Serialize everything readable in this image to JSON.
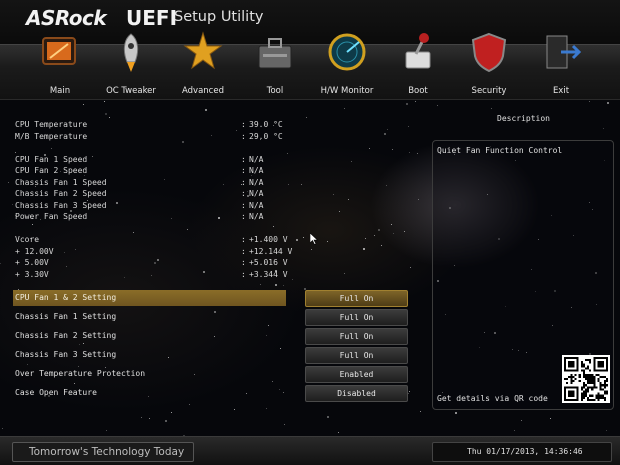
{
  "header": {
    "brand": "ASRock",
    "product": "UEFI",
    "subtitle": "Setup Utility"
  },
  "nav": [
    {
      "label": "Main",
      "icon": "main-icon",
      "color": "#d86a1c"
    },
    {
      "label": "OC Tweaker",
      "icon": "rocket-icon",
      "color": "#c8c8c8"
    },
    {
      "label": "Advanced",
      "icon": "star-burst-icon",
      "color": "#e0a020"
    },
    {
      "label": "Tool",
      "icon": "toolbox-icon",
      "color": "#666666"
    },
    {
      "label": "H/W Monitor",
      "icon": "radar-icon",
      "color": "#2a8fa8"
    },
    {
      "label": "Boot",
      "icon": "boot-lever-icon",
      "color": "#b82020"
    },
    {
      "label": "Security",
      "icon": "shield-icon",
      "color": "#c02020"
    },
    {
      "label": "Exit",
      "icon": "exit-door-icon",
      "color": "#3a7ad0"
    }
  ],
  "readings": [
    {
      "label": "CPU Temperature",
      "value": "39.0 °C"
    },
    {
      "label": "M/B Temperature",
      "value": "29.0 °C"
    },
    {
      "label": "CPU Fan 1 Speed",
      "value": "N/A"
    },
    {
      "label": "CPU Fan 2 Speed",
      "value": "N/A"
    },
    {
      "label": "Chassis Fan 1 Speed",
      "value": "N/A"
    },
    {
      "label": "Chassis Fan 2 Speed",
      "value": "N/A"
    },
    {
      "label": "Chassis Fan 3 Speed",
      "value": "N/A"
    },
    {
      "label": "Power Fan Speed",
      "value": "N/A"
    },
    {
      "label": "Vcore",
      "value": "+1.400 V"
    },
    {
      "label": "+ 12.00V",
      "value": "+12.144 V"
    },
    {
      "label": "+ 5.00V",
      "value": "+5.016 V"
    },
    {
      "label": "+ 3.30V",
      "value": "+3.344 V"
    }
  ],
  "separator": ":",
  "settings": [
    {
      "label": "CPU Fan 1 & 2 Setting",
      "value": "Full On",
      "selected": true
    },
    {
      "label": "Chassis Fan 1 Setting",
      "value": "Full On",
      "selected": false
    },
    {
      "label": "Chassis Fan 2 Setting",
      "value": "Full On",
      "selected": false
    },
    {
      "label": "Chassis Fan 3 Setting",
      "value": "Full On",
      "selected": false
    },
    {
      "label": "Over Temperature Protection",
      "value": "Enabled",
      "selected": false
    },
    {
      "label": "Case Open Feature",
      "value": "Disabled",
      "selected": false
    }
  ],
  "description": {
    "title": "Description",
    "text": "Quiet Fan Function Control",
    "qr_text": "Get details via QR code"
  },
  "footer": {
    "tagline": "Tomorrow's Technology Today",
    "datetime": "Thu 01/17/2013, 14:36:46"
  },
  "colors": {
    "highlight": "#8a6d28",
    "background": "#06070b"
  }
}
